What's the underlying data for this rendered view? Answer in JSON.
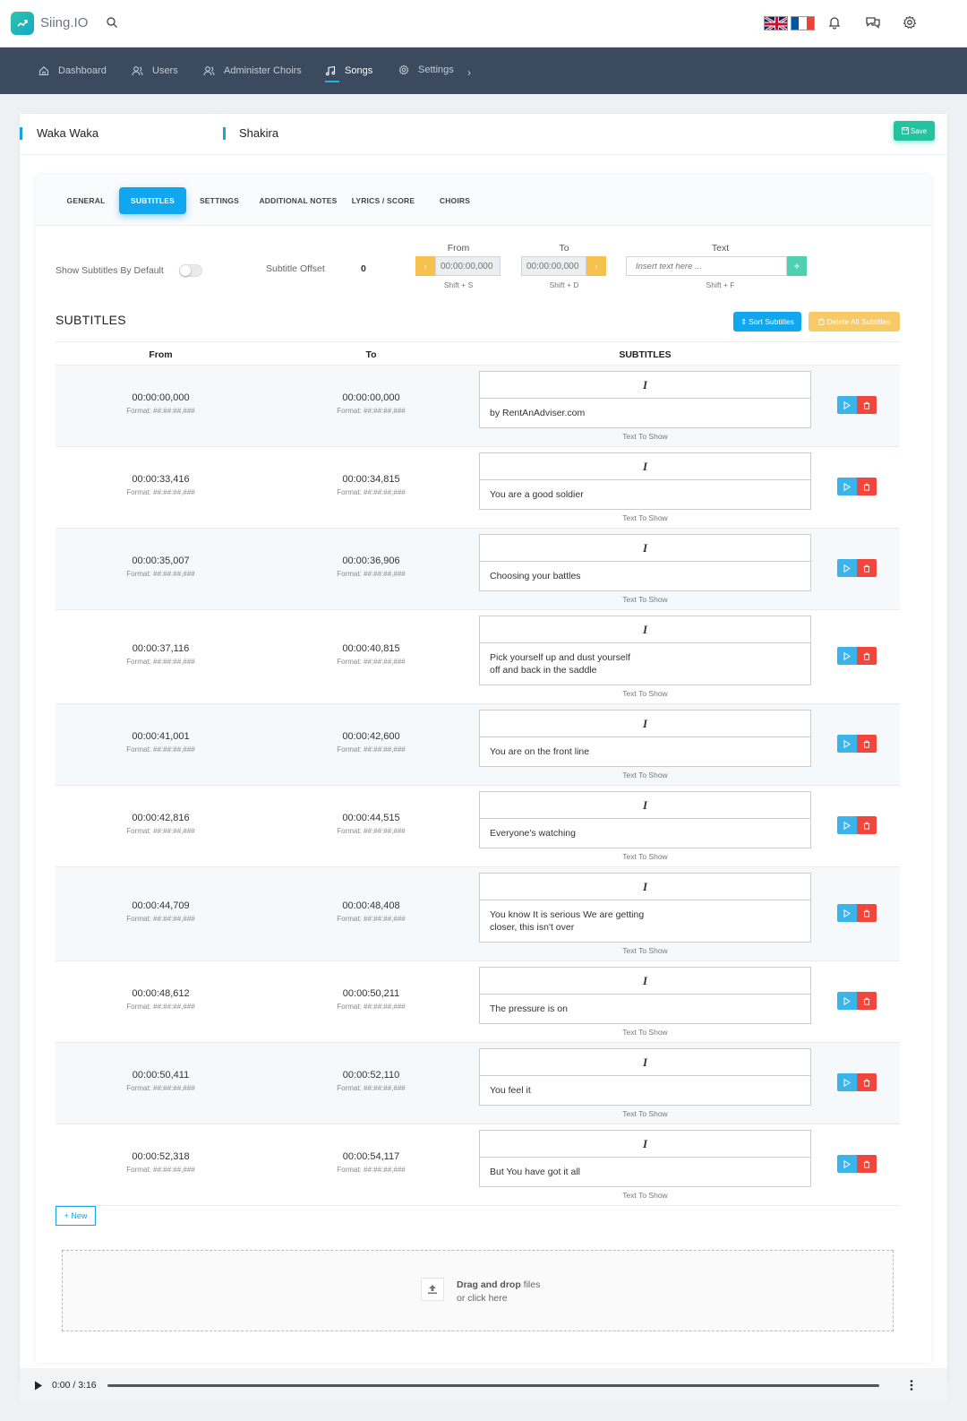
{
  "app": {
    "name": "Siing.IO",
    "brand_color": "#22b8c4"
  },
  "topbar": {
    "icons": [
      "search-icon",
      "uk-flag-icon",
      "fr-flag-icon",
      "bell-icon",
      "chat-icon",
      "gear-icon"
    ]
  },
  "nav": {
    "items": [
      {
        "label": "Dashboard",
        "icon": "home-icon"
      },
      {
        "label": "Users",
        "icon": "users-icon"
      },
      {
        "label": "Administer Choirs",
        "icon": "users-icon"
      },
      {
        "label": "Songs",
        "icon": "music-icon",
        "active": true
      },
      {
        "label": "Settings",
        "icon": "gear-icon"
      }
    ],
    "more": "›"
  },
  "song": {
    "title": "Waka Waka",
    "artist": "Shakira",
    "save_label": "Save"
  },
  "tabs": [
    "GENERAL",
    "SUBTITLES",
    "SETTINGS",
    "ADDITIONAL NOTES",
    "LYRICS / SCORE",
    "CHOIRS"
  ],
  "active_tab": "SUBTITLES",
  "controls": {
    "show_default_label": "Show Subtitles By Default",
    "show_default_on": false,
    "offset_label": "Subtitle Offset",
    "offset_value": "0",
    "from_label": "From",
    "to_label": "To",
    "text_label": "Text",
    "from_placeholder": "00:00:00,000",
    "to_placeholder": "00:00:00,000",
    "text_placeholder": "Insert text here ...",
    "from_shortcut": "Shift + S",
    "to_shortcut": "Shift + D",
    "text_shortcut": "Shift + F",
    "prev_glyph": "›",
    "next_glyph": "‹",
    "add_glyph": "+"
  },
  "subtitles_section": {
    "title": "SUBTITLES",
    "sort_label": "Sort Subtitles",
    "delete_all_label": "Delete All Subtitles",
    "col_from": "From",
    "col_to": "To",
    "col_subtitles": "SUBTITLES",
    "format_hint": "Format: ##:##:##,###",
    "text_caption": "Text To Show",
    "italic_glyph": "I",
    "rows": [
      {
        "from": "00:00:00,000",
        "to": "00:00:00,000",
        "text": "by RentAnAdviser.com"
      },
      {
        "from": "00:00:33,416",
        "to": "00:00:34,815",
        "text": "You are a good soldier"
      },
      {
        "from": "00:00:35,007",
        "to": "00:00:36,906",
        "text": "Choosing your battles"
      },
      {
        "from": "00:00:37,116",
        "to": "00:00:40,815",
        "text": "Pick yourself up and dust yourself\noff and back in the saddle"
      },
      {
        "from": "00:00:41,001",
        "to": "00:00:42,600",
        "text": "You are on the front line"
      },
      {
        "from": "00:00:42,816",
        "to": "00:00:44,515",
        "text": "Everyone's watching"
      },
      {
        "from": "00:00:44,709",
        "to": "00:00:48,408",
        "text": "You know It is serious We are getting\ncloser, this isn't over"
      },
      {
        "from": "00:00:48,612",
        "to": "00:00:50,211",
        "text": "The pressure is on"
      },
      {
        "from": "00:00:50,411",
        "to": "00:00:52,110",
        "text": "You feel it"
      },
      {
        "from": "00:00:52,318",
        "to": "00:00:54,117",
        "text": "But You have got it all"
      }
    ],
    "new_label": "+ New"
  },
  "dropzone": {
    "bold": "Drag and drop",
    "rest": " files",
    "line2": "or click here"
  },
  "audio": {
    "time": "0:00 / 3:16"
  }
}
